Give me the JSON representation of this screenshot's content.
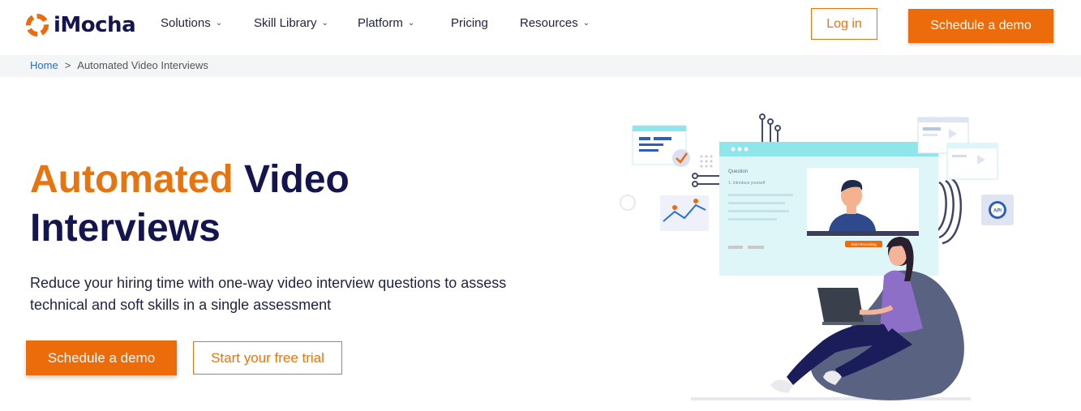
{
  "brand": {
    "name": "iMocha",
    "accent": "#ec6b0b",
    "navy": "#14154f"
  },
  "nav": {
    "items": [
      {
        "label": "Solutions",
        "dropdown": true
      },
      {
        "label": "Skill Library",
        "dropdown": true
      },
      {
        "label": "Platform",
        "dropdown": true
      },
      {
        "label": "Pricing",
        "dropdown": false
      },
      {
        "label": "Resources",
        "dropdown": true
      }
    ],
    "login_label": "Log in",
    "demo_label": "Schedule a demo"
  },
  "breadcrumb": {
    "home": "Home",
    "separator": ">",
    "current": "Automated Video Interviews"
  },
  "hero": {
    "title_highlight": "Automated",
    "title_rest_1": "Video",
    "title_rest_2": "Interviews",
    "subtitle": "Reduce your hiring time with one-way video interview questions to assess technical and soft skills in a single assessment",
    "primary_cta": "Schedule a demo",
    "secondary_cta": "Start your free trial"
  },
  "illustration": {
    "question_label": "Question",
    "question_text": "1. Introduce yourself",
    "record_button": "Start Recording",
    "api_badge": "API"
  }
}
